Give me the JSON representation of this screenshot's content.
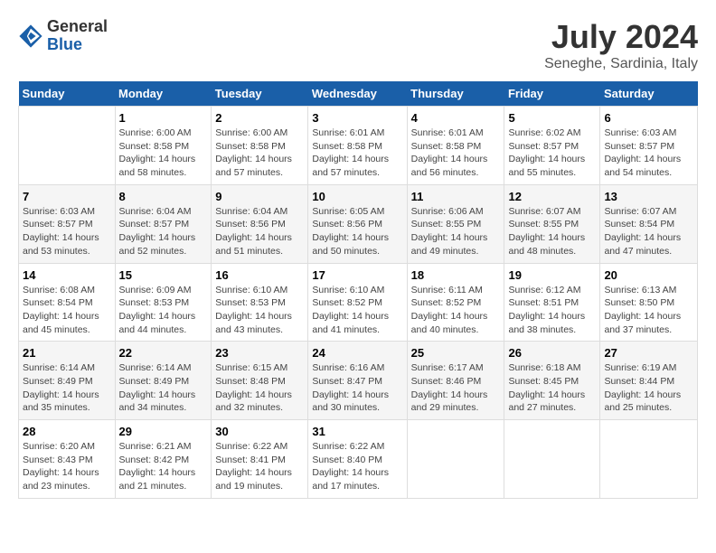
{
  "logo": {
    "general": "General",
    "blue": "Blue"
  },
  "title": "July 2024",
  "subtitle": "Seneghe, Sardinia, Italy",
  "days_of_week": [
    "Sunday",
    "Monday",
    "Tuesday",
    "Wednesday",
    "Thursday",
    "Friday",
    "Saturday"
  ],
  "weeks": [
    [
      {
        "day": "",
        "info": ""
      },
      {
        "day": "1",
        "info": "Sunrise: 6:00 AM\nSunset: 8:58 PM\nDaylight: 14 hours\nand 58 minutes."
      },
      {
        "day": "2",
        "info": "Sunrise: 6:00 AM\nSunset: 8:58 PM\nDaylight: 14 hours\nand 57 minutes."
      },
      {
        "day": "3",
        "info": "Sunrise: 6:01 AM\nSunset: 8:58 PM\nDaylight: 14 hours\nand 57 minutes."
      },
      {
        "day": "4",
        "info": "Sunrise: 6:01 AM\nSunset: 8:58 PM\nDaylight: 14 hours\nand 56 minutes."
      },
      {
        "day": "5",
        "info": "Sunrise: 6:02 AM\nSunset: 8:57 PM\nDaylight: 14 hours\nand 55 minutes."
      },
      {
        "day": "6",
        "info": "Sunrise: 6:03 AM\nSunset: 8:57 PM\nDaylight: 14 hours\nand 54 minutes."
      }
    ],
    [
      {
        "day": "7",
        "info": "Sunrise: 6:03 AM\nSunset: 8:57 PM\nDaylight: 14 hours\nand 53 minutes."
      },
      {
        "day": "8",
        "info": "Sunrise: 6:04 AM\nSunset: 8:57 PM\nDaylight: 14 hours\nand 52 minutes."
      },
      {
        "day": "9",
        "info": "Sunrise: 6:04 AM\nSunset: 8:56 PM\nDaylight: 14 hours\nand 51 minutes."
      },
      {
        "day": "10",
        "info": "Sunrise: 6:05 AM\nSunset: 8:56 PM\nDaylight: 14 hours\nand 50 minutes."
      },
      {
        "day": "11",
        "info": "Sunrise: 6:06 AM\nSunset: 8:55 PM\nDaylight: 14 hours\nand 49 minutes."
      },
      {
        "day": "12",
        "info": "Sunrise: 6:07 AM\nSunset: 8:55 PM\nDaylight: 14 hours\nand 48 minutes."
      },
      {
        "day": "13",
        "info": "Sunrise: 6:07 AM\nSunset: 8:54 PM\nDaylight: 14 hours\nand 47 minutes."
      }
    ],
    [
      {
        "day": "14",
        "info": "Sunrise: 6:08 AM\nSunset: 8:54 PM\nDaylight: 14 hours\nand 45 minutes."
      },
      {
        "day": "15",
        "info": "Sunrise: 6:09 AM\nSunset: 8:53 PM\nDaylight: 14 hours\nand 44 minutes."
      },
      {
        "day": "16",
        "info": "Sunrise: 6:10 AM\nSunset: 8:53 PM\nDaylight: 14 hours\nand 43 minutes."
      },
      {
        "day": "17",
        "info": "Sunrise: 6:10 AM\nSunset: 8:52 PM\nDaylight: 14 hours\nand 41 minutes."
      },
      {
        "day": "18",
        "info": "Sunrise: 6:11 AM\nSunset: 8:52 PM\nDaylight: 14 hours\nand 40 minutes."
      },
      {
        "day": "19",
        "info": "Sunrise: 6:12 AM\nSunset: 8:51 PM\nDaylight: 14 hours\nand 38 minutes."
      },
      {
        "day": "20",
        "info": "Sunrise: 6:13 AM\nSunset: 8:50 PM\nDaylight: 14 hours\nand 37 minutes."
      }
    ],
    [
      {
        "day": "21",
        "info": "Sunrise: 6:14 AM\nSunset: 8:49 PM\nDaylight: 14 hours\nand 35 minutes."
      },
      {
        "day": "22",
        "info": "Sunrise: 6:14 AM\nSunset: 8:49 PM\nDaylight: 14 hours\nand 34 minutes."
      },
      {
        "day": "23",
        "info": "Sunrise: 6:15 AM\nSunset: 8:48 PM\nDaylight: 14 hours\nand 32 minutes."
      },
      {
        "day": "24",
        "info": "Sunrise: 6:16 AM\nSunset: 8:47 PM\nDaylight: 14 hours\nand 30 minutes."
      },
      {
        "day": "25",
        "info": "Sunrise: 6:17 AM\nSunset: 8:46 PM\nDaylight: 14 hours\nand 29 minutes."
      },
      {
        "day": "26",
        "info": "Sunrise: 6:18 AM\nSunset: 8:45 PM\nDaylight: 14 hours\nand 27 minutes."
      },
      {
        "day": "27",
        "info": "Sunrise: 6:19 AM\nSunset: 8:44 PM\nDaylight: 14 hours\nand 25 minutes."
      }
    ],
    [
      {
        "day": "28",
        "info": "Sunrise: 6:20 AM\nSunset: 8:43 PM\nDaylight: 14 hours\nand 23 minutes."
      },
      {
        "day": "29",
        "info": "Sunrise: 6:21 AM\nSunset: 8:42 PM\nDaylight: 14 hours\nand 21 minutes."
      },
      {
        "day": "30",
        "info": "Sunrise: 6:22 AM\nSunset: 8:41 PM\nDaylight: 14 hours\nand 19 minutes."
      },
      {
        "day": "31",
        "info": "Sunrise: 6:22 AM\nSunset: 8:40 PM\nDaylight: 14 hours\nand 17 minutes."
      },
      {
        "day": "",
        "info": ""
      },
      {
        "day": "",
        "info": ""
      },
      {
        "day": "",
        "info": ""
      }
    ]
  ]
}
